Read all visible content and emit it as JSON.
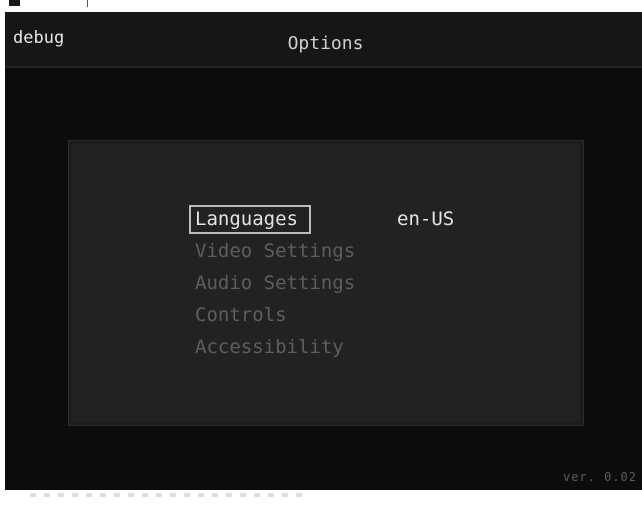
{
  "game": {
    "debug_label": "debug",
    "title": "Options",
    "version": "ver. 0.02"
  },
  "menu": {
    "items": [
      {
        "label": "Languages",
        "selected": true
      },
      {
        "label": "Video Settings",
        "selected": false
      },
      {
        "label": "Audio Settings",
        "selected": false
      },
      {
        "label": "Controls",
        "selected": false
      },
      {
        "label": "Accessibility",
        "selected": false
      }
    ],
    "language_value": "en-US"
  },
  "colors": {
    "background": "#0c0c0c",
    "header": "#161616",
    "panel": "#222222",
    "selected_text": "#e4e4e4",
    "unselected_text": "#5e5e5e",
    "selection_frame": "#bdbdbd"
  }
}
